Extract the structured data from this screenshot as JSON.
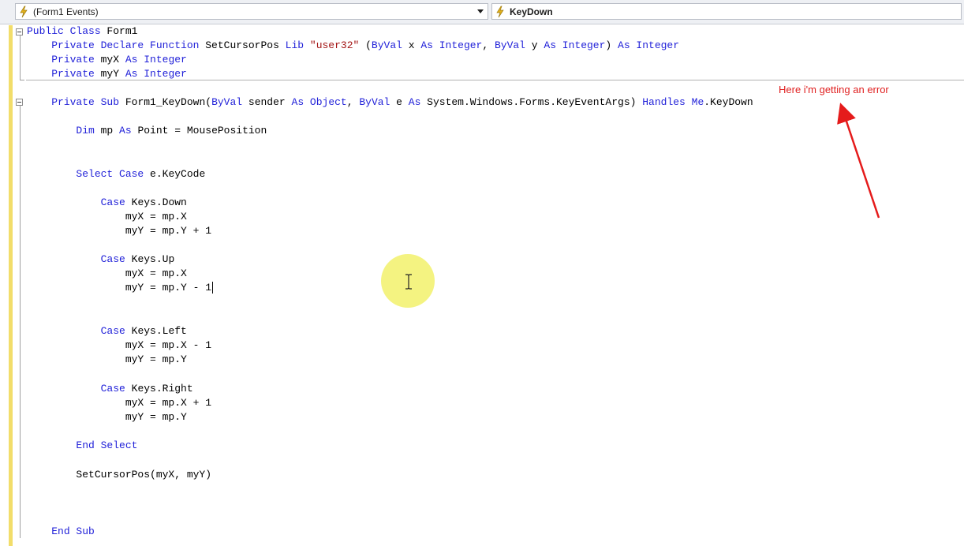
{
  "toolbar": {
    "class_combo": {
      "value": "(Form1 Events)",
      "icon": "lightning-bolt-icon"
    },
    "method_combo": {
      "value": "KeyDown",
      "icon": "lightning-bolt-icon"
    }
  },
  "code": {
    "lines": [
      [
        [
          "kw",
          "Public Class"
        ],
        [
          "t",
          " Form1"
        ]
      ],
      [
        [
          "t",
          "    "
        ],
        [
          "kw",
          "Private Declare Function"
        ],
        [
          "t",
          " SetCursorPos "
        ],
        [
          "kw",
          "Lib"
        ],
        [
          "t",
          " "
        ],
        [
          "str",
          "\"user32\""
        ],
        [
          "t",
          " ("
        ],
        [
          "kw",
          "ByVal"
        ],
        [
          "t",
          " x "
        ],
        [
          "kw",
          "As Integer"
        ],
        [
          "t",
          ", "
        ],
        [
          "kw",
          "ByVal"
        ],
        [
          "t",
          " y "
        ],
        [
          "kw",
          "As Integer"
        ],
        [
          "t",
          ") "
        ],
        [
          "kw",
          "As Integer"
        ]
      ],
      [
        [
          "t",
          "    "
        ],
        [
          "kw",
          "Private"
        ],
        [
          "t",
          " myX "
        ],
        [
          "kw",
          "As Integer"
        ]
      ],
      [
        [
          "t",
          "    "
        ],
        [
          "kw",
          "Private"
        ],
        [
          "t",
          " myY "
        ],
        [
          "kw",
          "As Integer"
        ]
      ],
      [
        [
          "t",
          ""
        ]
      ],
      [
        [
          "t",
          "    "
        ],
        [
          "kw",
          "Private Sub"
        ],
        [
          "t",
          " Form1_KeyDown("
        ],
        [
          "kw",
          "ByVal"
        ],
        [
          "t",
          " sender "
        ],
        [
          "kw",
          "As Object"
        ],
        [
          "t",
          ", "
        ],
        [
          "kw",
          "ByVal"
        ],
        [
          "t",
          " e "
        ],
        [
          "kw",
          "As"
        ],
        [
          "t",
          " System.Windows.Forms.KeyEventArgs) "
        ],
        [
          "kw",
          "Handles Me"
        ],
        [
          "t",
          ".KeyDown"
        ]
      ],
      [
        [
          "t",
          ""
        ]
      ],
      [
        [
          "t",
          "        "
        ],
        [
          "kw",
          "Dim"
        ],
        [
          "t",
          " mp "
        ],
        [
          "kw",
          "As"
        ],
        [
          "t",
          " Point = MousePosition"
        ]
      ],
      [
        [
          "t",
          ""
        ]
      ],
      [
        [
          "t",
          ""
        ]
      ],
      [
        [
          "t",
          "        "
        ],
        [
          "kw",
          "Select Case"
        ],
        [
          "t",
          " e.KeyCode"
        ]
      ],
      [
        [
          "t",
          ""
        ]
      ],
      [
        [
          "t",
          "            "
        ],
        [
          "kw",
          "Case"
        ],
        [
          "t",
          " Keys.Down"
        ]
      ],
      [
        [
          "t",
          "                myX = mp.X"
        ]
      ],
      [
        [
          "t",
          "                myY = mp.Y + 1"
        ]
      ],
      [
        [
          "t",
          ""
        ]
      ],
      [
        [
          "t",
          "            "
        ],
        [
          "kw",
          "Case"
        ],
        [
          "t",
          " Keys.Up"
        ]
      ],
      [
        [
          "t",
          "                myX = mp.X"
        ]
      ],
      [
        [
          "t",
          "                myY = mp.Y - 1"
        ]
      ],
      [
        [
          "t",
          ""
        ]
      ],
      [
        [
          "t",
          ""
        ]
      ],
      [
        [
          "t",
          "            "
        ],
        [
          "kw",
          "Case"
        ],
        [
          "t",
          " Keys.Left"
        ]
      ],
      [
        [
          "t",
          "                myX = mp.X - 1"
        ]
      ],
      [
        [
          "t",
          "                myY = mp.Y"
        ]
      ],
      [
        [
          "t",
          ""
        ]
      ],
      [
        [
          "t",
          "            "
        ],
        [
          "kw",
          "Case"
        ],
        [
          "t",
          " Keys.Right"
        ]
      ],
      [
        [
          "t",
          "                myX = mp.X + 1"
        ]
      ],
      [
        [
          "t",
          "                myY = mp.Y"
        ]
      ],
      [
        [
          "t",
          ""
        ]
      ],
      [
        [
          "t",
          "        "
        ],
        [
          "kw",
          "End Select"
        ]
      ],
      [
        [
          "t",
          ""
        ]
      ],
      [
        [
          "t",
          "        SetCursorPos(myX, myY)"
        ]
      ],
      [
        [
          "t",
          ""
        ]
      ],
      [
        [
          "t",
          ""
        ]
      ],
      [
        [
          "t",
          ""
        ]
      ],
      [
        [
          "t",
          "    "
        ],
        [
          "kw",
          "End Sub"
        ]
      ]
    ],
    "caret_line": 18
  },
  "annotation": {
    "text": "Here i'm getting an error",
    "color": "#e02020"
  },
  "colors": {
    "keyword": "#1f1fd8",
    "string": "#a31515",
    "margin": "#f2dd6a",
    "highlight": "#f3f27a"
  }
}
